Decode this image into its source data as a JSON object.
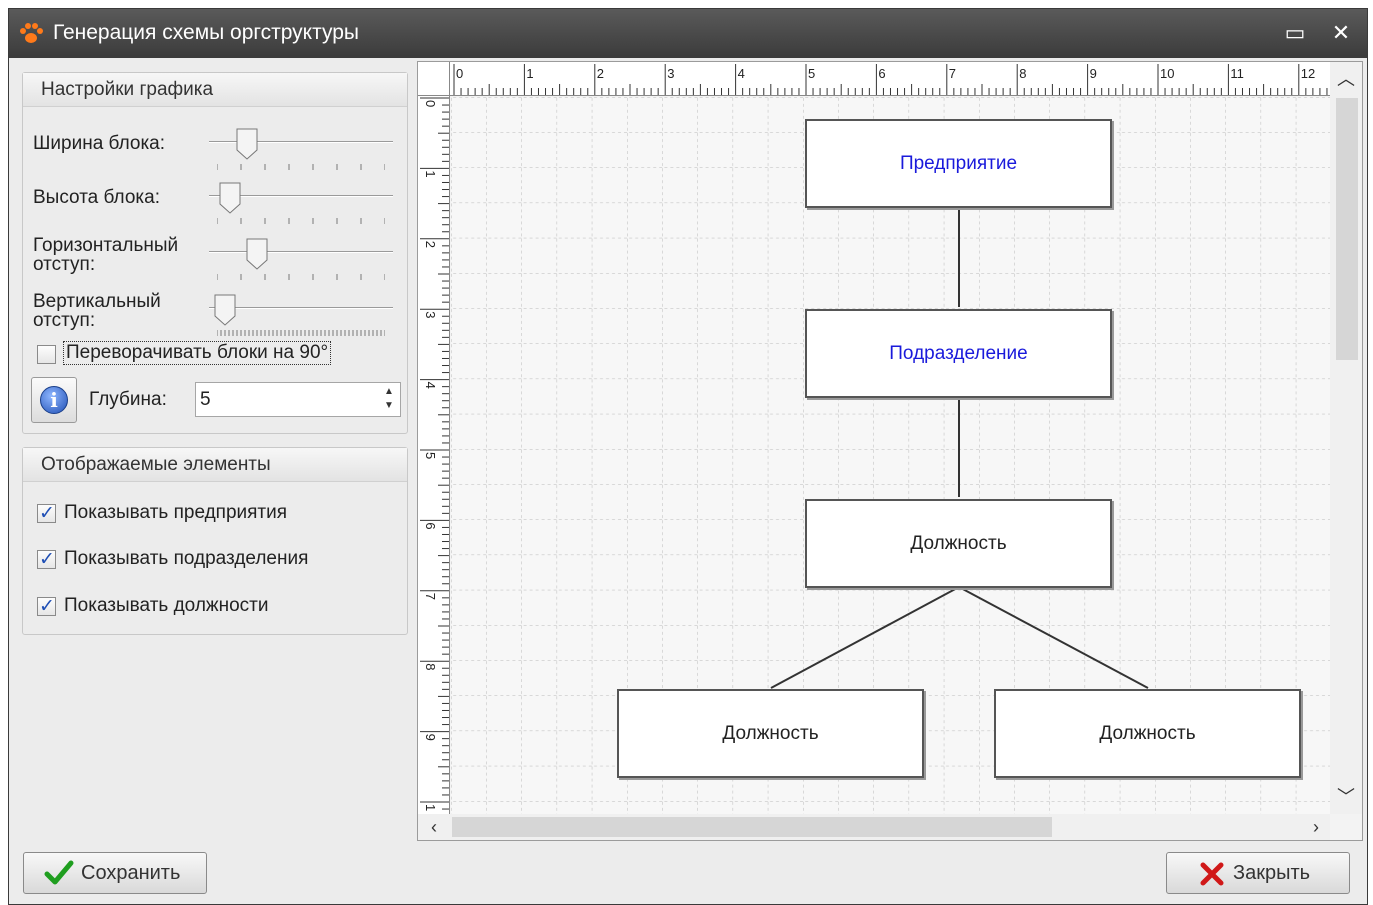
{
  "window": {
    "title": "Генерация схемы оргструктуры",
    "minimize_glyph": "▭",
    "close_glyph": "✕"
  },
  "settings": {
    "group_title": "Настройки графика",
    "block_width": {
      "label": "Ширина блока:",
      "level": 0.22
    },
    "block_height": {
      "label": "Высота блока:",
      "level": 0.12
    },
    "h_offset": {
      "label_line1": "Горизонтальный",
      "label_line2": "отступ:",
      "level": 0.27
    },
    "v_offset": {
      "label_line1": "Вертикальный",
      "label_line2": "отступ:",
      "level": 0.09
    },
    "rotate_checkbox": {
      "label": "Переворачивать блоки на 90°",
      "checked": false
    },
    "depth": {
      "label": "Глубина:",
      "value": "5"
    }
  },
  "elements": {
    "group_title": "Отображаемые элементы",
    "show_enterprises": "Показывать предприятия",
    "show_departments": "Показывать подразделения",
    "show_positions": "Показывать должности"
  },
  "ruler": {
    "h_labels": [
      "0",
      "1",
      "2",
      "3",
      "4",
      "5",
      "6",
      "7",
      "8",
      "9",
      "10",
      "11",
      "12"
    ],
    "v_labels": [
      "0",
      "1",
      "2",
      "3",
      "4",
      "5",
      "6",
      "7",
      "8",
      "9",
      "1"
    ]
  },
  "diagram": {
    "enterprise": "Предприятие",
    "department": "Подразделение",
    "position_top": "Должность",
    "position_left": "Должность",
    "position_right": "Должность",
    "link_color": "#1a1adb"
  },
  "footer": {
    "save_label": "Сохранить",
    "close_label": "Закрыть"
  }
}
